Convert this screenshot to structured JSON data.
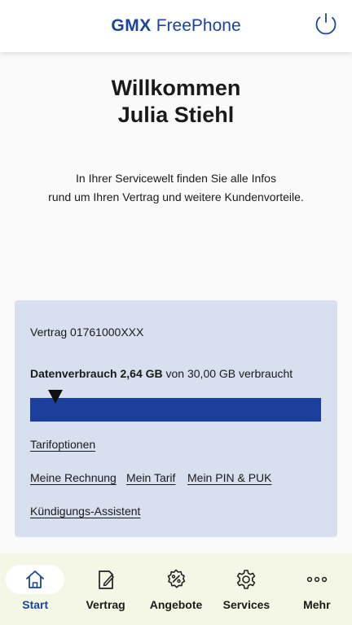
{
  "header": {
    "brand": "GMX",
    "product": "FreePhone"
  },
  "welcome": {
    "line1": "Willkommen",
    "line2": "Julia Stiehl"
  },
  "intro": {
    "line1": "In Ihrer Servicewelt finden Sie alle Infos",
    "line2": "rund um Ihren Vertrag und weitere Kundenvorteile."
  },
  "contract": {
    "label": "Vertrag 01761000XXX",
    "usage_label": "Datenverbrauch",
    "used": "2,64 GB",
    "of_text": "von 30,00 GB verbraucht",
    "used_fraction": 0.088,
    "links": {
      "tariff_options": "Tarifoptionen",
      "invoice": "Meine Rechnung",
      "tariff": "Mein Tarif",
      "pin_puk": "Mein PIN & PUK",
      "cancellation": "Kündigungs-Assistent"
    }
  },
  "tabs": [
    {
      "label": "Start",
      "icon": "home-icon",
      "active": true
    },
    {
      "label": "Vertrag",
      "icon": "contract-icon",
      "active": false
    },
    {
      "label": "Angebote",
      "icon": "offers-icon",
      "active": false
    },
    {
      "label": "Services",
      "icon": "gear-icon",
      "active": false
    },
    {
      "label": "Mehr",
      "icon": "more-icon",
      "active": false
    }
  ],
  "colors": {
    "brand": "#1c449b",
    "bar": "#1c3f9c",
    "card": "#d8dfef",
    "tabbar": "#f4f6e6"
  }
}
